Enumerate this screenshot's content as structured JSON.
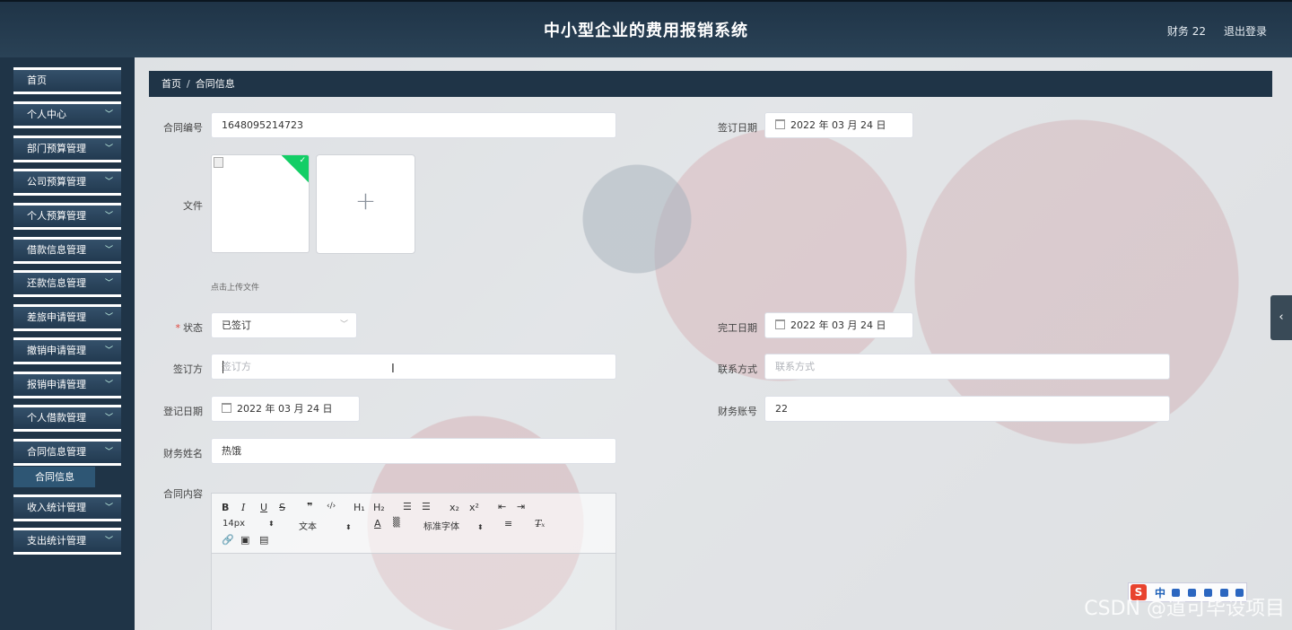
{
  "app": {
    "title": "中小型企业的费用报销系统",
    "user": "财务 22",
    "logout": "退出登录"
  },
  "sidebar": {
    "items": [
      {
        "label": "首页",
        "chevron": false
      },
      {
        "label": "个人中心",
        "chevron": true
      },
      {
        "label": "部门预算管理",
        "chevron": true
      },
      {
        "label": "公司预算管理",
        "chevron": true
      },
      {
        "label": "个人预算管理",
        "chevron": true
      },
      {
        "label": "借款信息管理",
        "chevron": true
      },
      {
        "label": "还款信息管理",
        "chevron": true
      },
      {
        "label": "差旅申请管理",
        "chevron": true
      },
      {
        "label": "撤销申请管理",
        "chevron": true
      },
      {
        "label": "报销申请管理",
        "chevron": true
      },
      {
        "label": "个人借款管理",
        "chevron": true
      },
      {
        "label": "合同信息管理",
        "chevron": true
      },
      {
        "label": "收入统计管理",
        "chevron": true
      },
      {
        "label": "支出统计管理",
        "chevron": true
      }
    ],
    "submenu": {
      "label": "合同信息"
    }
  },
  "breadcrumb": {
    "home": "首页",
    "separator": "/",
    "current": "合同信息"
  },
  "form": {
    "contract_no": {
      "label": "合同编号",
      "value": "1648095214723"
    },
    "sign_date": {
      "label": "签订日期",
      "value": "2022 年 03 月 24 日"
    },
    "file": {
      "label": "文件",
      "tip": "点击上传文件",
      "add": "+"
    },
    "status": {
      "label": "状态",
      "required": "*",
      "value": "已签订"
    },
    "finish_date": {
      "label": "完工日期",
      "value": "2022 年 03 月 24 日"
    },
    "signer": {
      "label": "签订方",
      "placeholder": "签订方"
    },
    "contact": {
      "label": "联系方式",
      "placeholder": "联系方式"
    },
    "register_date": {
      "label": "登记日期",
      "value": "2022 年 03 月 24 日"
    },
    "finance_account": {
      "label": "财务账号",
      "value": "22"
    },
    "finance_name": {
      "label": "财务姓名",
      "value": "热饿"
    },
    "content": {
      "label": "合同内容"
    }
  },
  "editor": {
    "font_size": "14px",
    "text_type": "文本",
    "font_family": "标准字体"
  },
  "ime": {
    "label": "中"
  },
  "watermark": "CSDN @道可毕设项目",
  "colors": {
    "header": "#1f3447",
    "sidebar": "#1f3447",
    "accent_green": "#13ce66",
    "required": "#e0453b"
  }
}
